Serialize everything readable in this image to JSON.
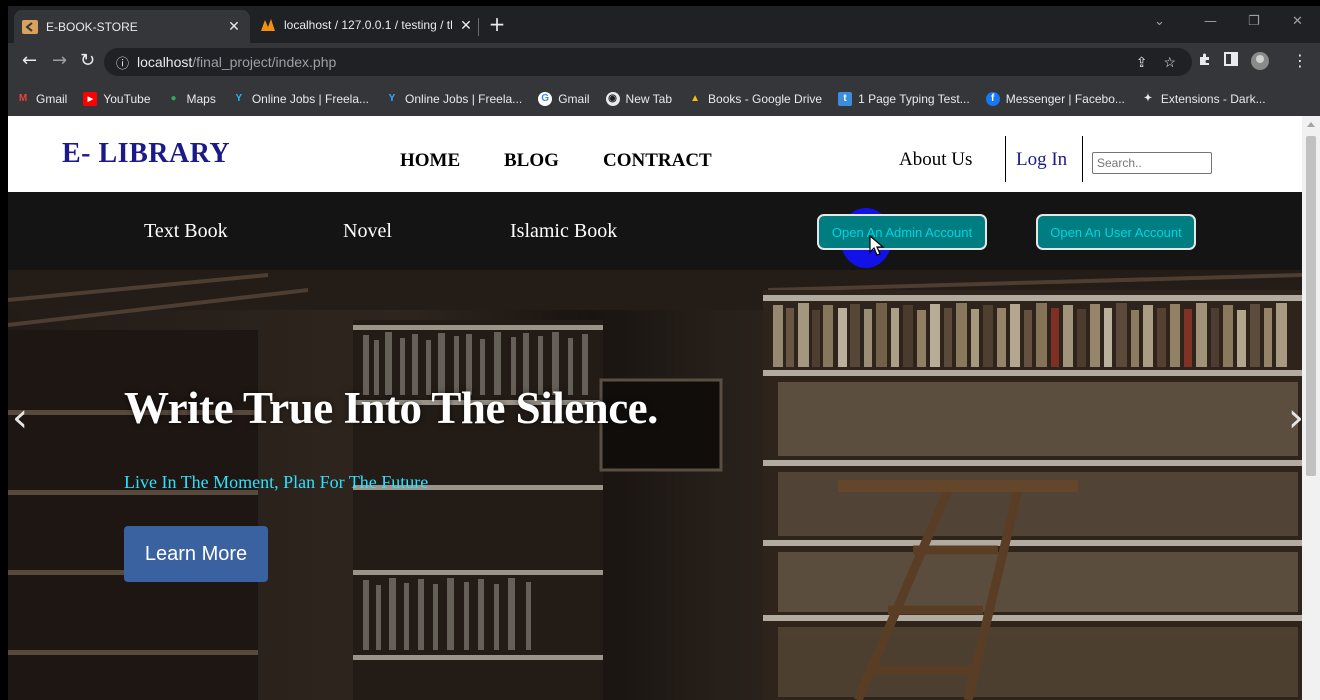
{
  "browser": {
    "tabs": [
      {
        "title": "E-BOOK-STORE",
        "active": true
      },
      {
        "title": "localhost / 127.0.0.1 / testing / tl",
        "active": false
      }
    ],
    "url_host": "localhost",
    "url_path": "/final_project/index.php",
    "bookmarks": [
      {
        "label": "Gmail",
        "icon": "gmail-icon"
      },
      {
        "label": "YouTube",
        "icon": "youtube-icon"
      },
      {
        "label": "Maps",
        "icon": "maps-icon"
      },
      {
        "label": "Online Jobs | Freela...",
        "icon": "freelancer-icon"
      },
      {
        "label": "Online Jobs | Freela...",
        "icon": "freelancer-icon"
      },
      {
        "label": "Gmail",
        "icon": "google-icon"
      },
      {
        "label": "New Tab",
        "icon": "chrome-icon"
      },
      {
        "label": "Books - Google Drive",
        "icon": "drive-icon"
      },
      {
        "label": "1 Page Typing Test...",
        "icon": "typing-test-icon"
      },
      {
        "label": "Messenger | Facebo...",
        "icon": "messenger-icon"
      },
      {
        "label": "Extensions - Dark...",
        "icon": "puzzle-icon"
      }
    ]
  },
  "site": {
    "logo": "E- LIBRARY",
    "nav": {
      "home": "HOME",
      "blog": "BLOG",
      "contract": "CONTRACT",
      "about": "About Us",
      "login": "Log In"
    },
    "search_placeholder": "Search..",
    "categories": [
      "Text Book",
      "Novel",
      "Islamic Book"
    ],
    "admin_button": "Open An Admin Account",
    "user_button": "Open An User Account",
    "hero": {
      "title": "Write True Into The Silence.",
      "subtitle": "Live In The Moment, Plan For The Future",
      "cta": "Learn More"
    }
  },
  "colors": {
    "logo": "#1a1a8c",
    "account_button_bg": "#007d80",
    "account_button_text": "#00d4e0",
    "hero_subtitle": "#2fe0ff",
    "cta_bg": "#3b62a0"
  }
}
